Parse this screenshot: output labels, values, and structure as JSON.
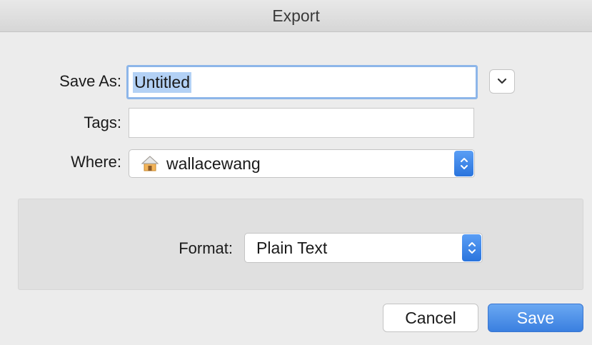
{
  "window": {
    "title": "Export"
  },
  "form": {
    "save_as_label": "Save As:",
    "save_as_value": "Untitled",
    "tags_label": "Tags:",
    "tags_value": "",
    "where_label": "Where:",
    "where_value": "wallacewang",
    "where_icon": "home-folder-icon"
  },
  "options": {
    "format_label": "Format:",
    "format_value": "Plain Text"
  },
  "buttons": {
    "cancel_label": "Cancel",
    "save_label": "Save"
  },
  "colors": {
    "accent": "#3a7fe0",
    "focus_ring": "#8db6e9",
    "selection": "#b3d1f5"
  }
}
